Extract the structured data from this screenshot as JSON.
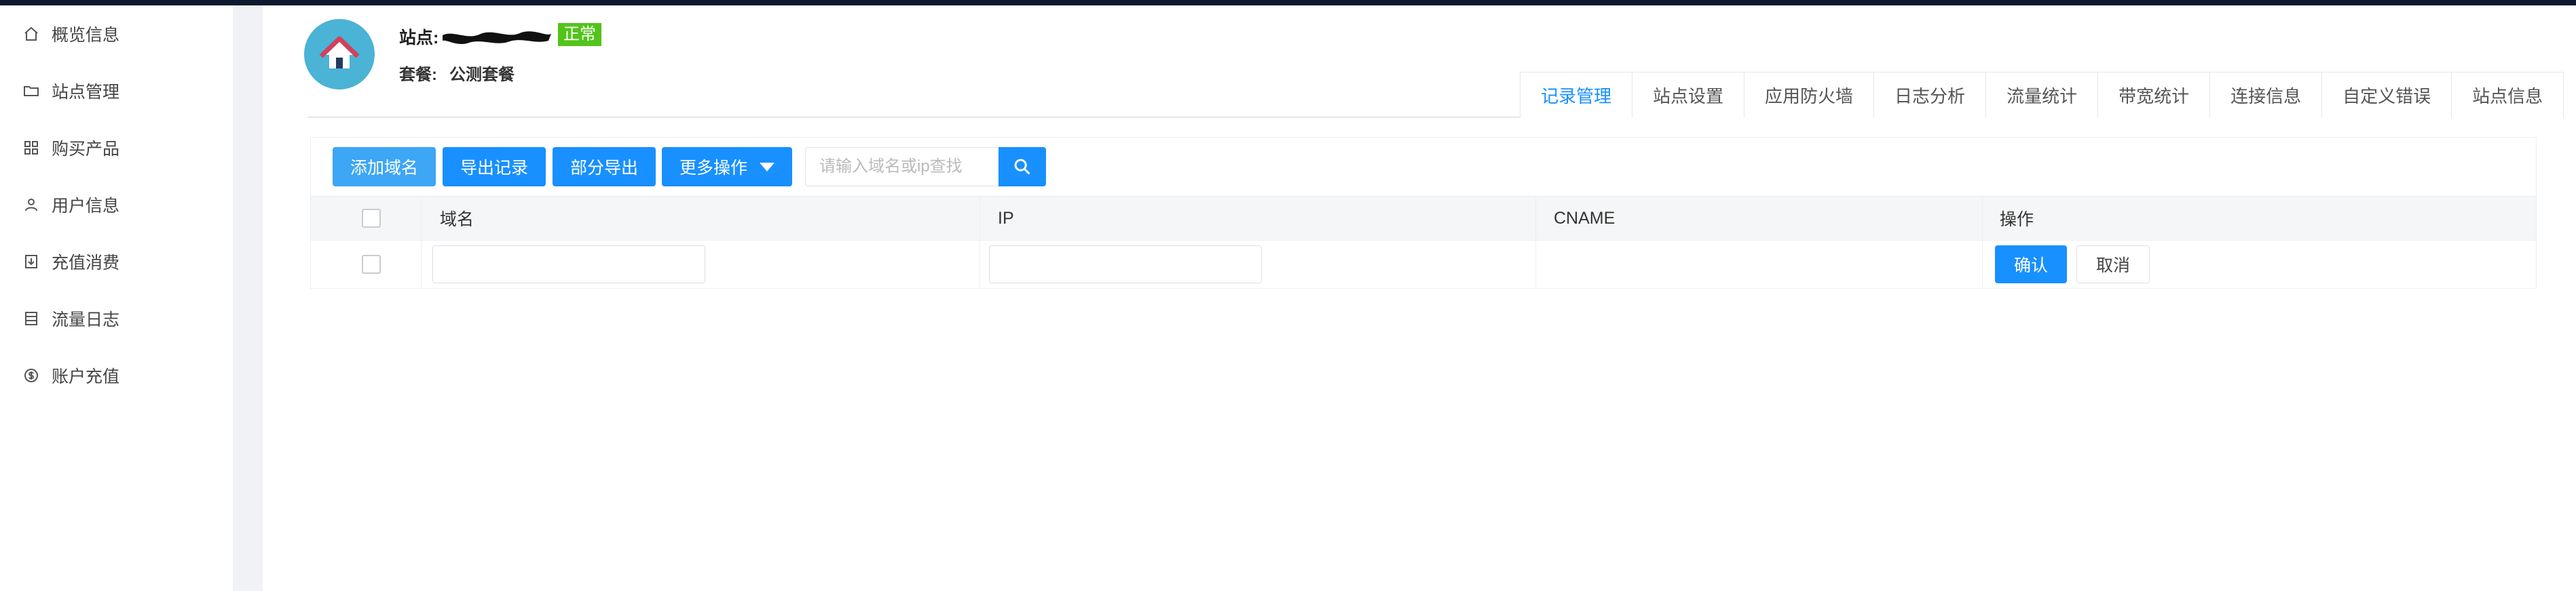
{
  "sidebar": {
    "items": [
      {
        "label": "概览信息",
        "icon": "home-icon"
      },
      {
        "label": "站点管理",
        "icon": "folder-icon"
      },
      {
        "label": "购买产品",
        "icon": "grid-icon"
      },
      {
        "label": "用户信息",
        "icon": "user-icon"
      },
      {
        "label": "充值消费",
        "icon": "download-box-icon"
      },
      {
        "label": "流量日志",
        "icon": "document-icon"
      },
      {
        "label": "账户充值",
        "icon": "dollar-circle-icon"
      }
    ]
  },
  "header": {
    "site_label": "站点:",
    "status_badge": "正常",
    "plan_label": "套餐:",
    "plan_value": "公测套餐"
  },
  "tabs": [
    "记录管理",
    "站点设置",
    "应用防火墙",
    "日志分析",
    "流量统计",
    "带宽统计",
    "连接信息",
    "自定义错误",
    "站点信息"
  ],
  "active_tab": "记录管理",
  "toolbar": {
    "add_domain": "添加域名",
    "export_records": "导出记录",
    "partial_export": "部分导出",
    "more_actions": "更多操作",
    "search_placeholder": "请输入域名或ip查找"
  },
  "table": {
    "columns": {
      "domain": "域名",
      "ip": "IP",
      "cname": "CNAME",
      "actions": "操作"
    },
    "row": {
      "domain_value": "",
      "ip_value": "",
      "confirm": "确认",
      "cancel": "取消"
    }
  },
  "colors": {
    "primary": "#1890ff",
    "success": "#52c41a",
    "logo_bg": "#4ab3d6",
    "topbar": "#0b1a2e"
  }
}
